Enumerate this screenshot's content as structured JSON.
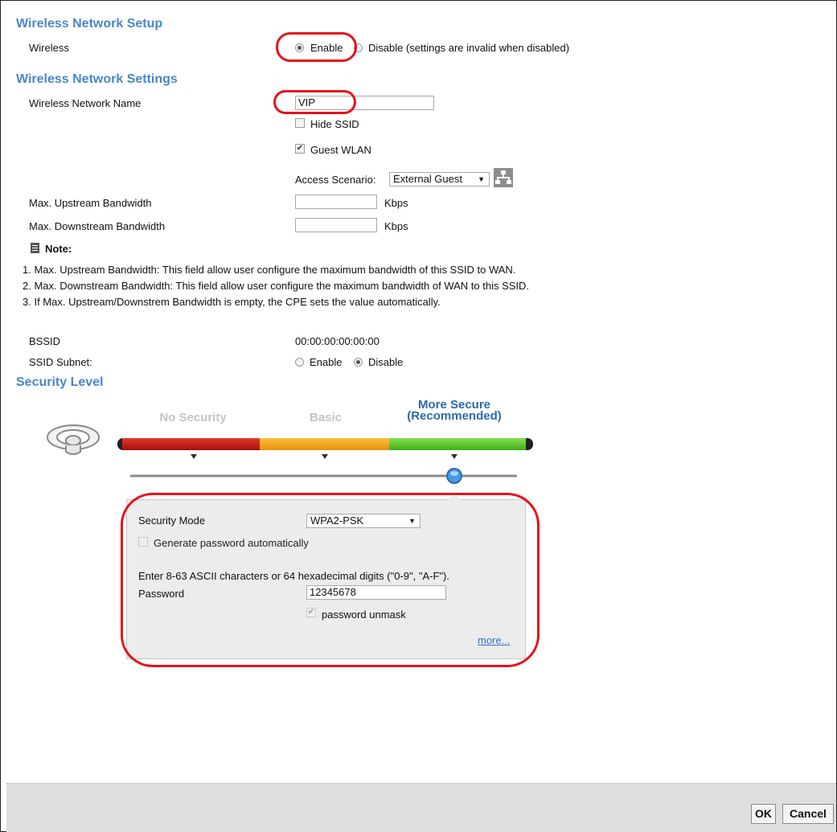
{
  "setup": {
    "title": "Wireless Network Setup",
    "wireless_label": "Wireless",
    "enable_label": "Enable",
    "disable_label": "Disable (settings are invalid when disabled)"
  },
  "settings": {
    "title": "Wireless Network Settings",
    "name_label": "Wireless Network Name",
    "name_value": "VIP",
    "hide_ssid_label": "Hide SSID",
    "guest_wlan_label": "Guest WLAN",
    "access_scenario_label": "Access Scenario:",
    "access_scenario_value": "External Guest",
    "upstream_label": "Max. Upstream Bandwidth",
    "downstream_label": "Max. Downstream Bandwidth",
    "kbps_unit": "Kbps",
    "note_title": "Note:",
    "notes": [
      "1. Max. Upstream Bandwidth: This field allow user configure the maximum bandwidth of this SSID to WAN.",
      "2. Max. Downstream Bandwidth: This field allow user configure the maximum bandwidth of WAN to this SSID.",
      "3. If Max. Upstream/Downstrem Bandwidth is empty, the CPE sets the value automatically."
    ],
    "bssid_label": "BSSID",
    "bssid_value": "00:00:00:00:00:00",
    "ssid_subnet_label": "SSID Subnet:",
    "ssid_subnet_enable": "Enable",
    "ssid_subnet_disable": "Disable"
  },
  "security": {
    "title": "Security Level",
    "levels": [
      "No Security",
      "Basic",
      "More Secure\n(Recommended)"
    ],
    "level_colors": [
      "#c0150c",
      "#f5a623",
      "#5cc22d"
    ],
    "mode_label": "Security Mode",
    "mode_value": "WPA2-PSK",
    "generate_label": "Generate password automatically",
    "hint": "Enter 8-63 ASCII characters or 64 hexadecimal digits (\"0-9\", \"A-F\").",
    "password_label": "Password",
    "password_value": "12345678",
    "unmask_label": "password unmask",
    "more_link": "more..."
  },
  "footer": {
    "ok_label": "OK",
    "cancel_label": "Cancel"
  }
}
